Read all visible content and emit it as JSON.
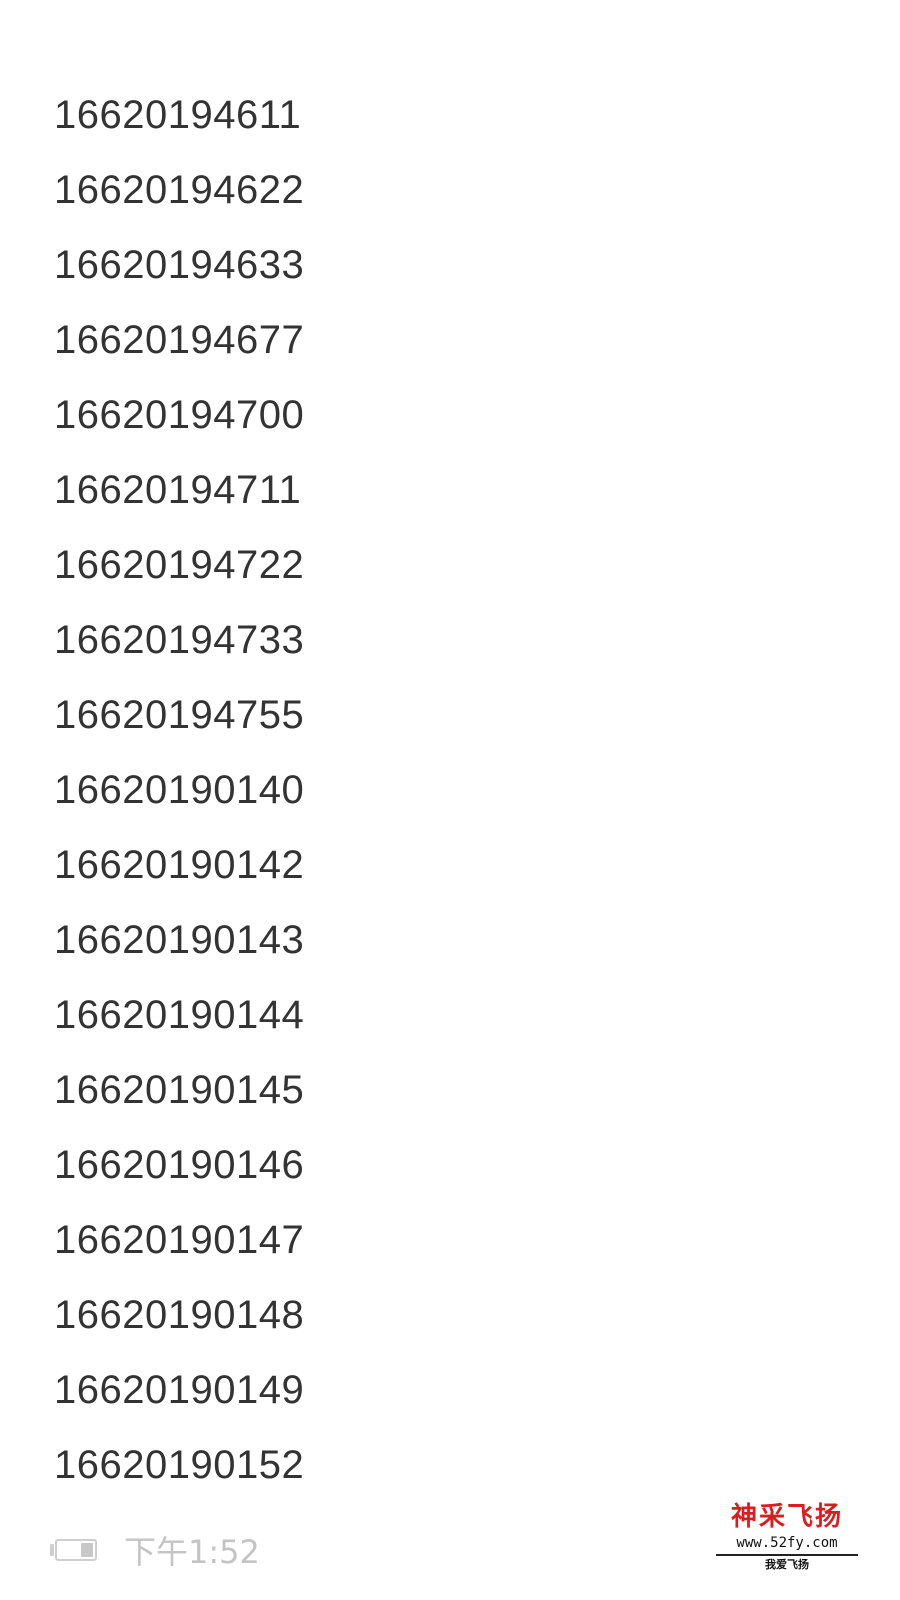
{
  "numbers": [
    "16620194611",
    "16620194622",
    "16620194633",
    "16620194677",
    "16620194700",
    "16620194711",
    "16620194722",
    "16620194733",
    "16620194755",
    "16620190140",
    "16620190142",
    "16620190143",
    "16620190144",
    "16620190145",
    "16620190146",
    "16620190147",
    "16620190148",
    "16620190149",
    "16620190152"
  ],
  "status_bar": {
    "time": "下午1:52",
    "battery_level": 0.35,
    "battery_icon": "battery-icon"
  },
  "watermark": {
    "title": "神采飞扬",
    "url": "www.52fy.com",
    "slogan": "我爱飞扬"
  },
  "colors": {
    "text": "#333333",
    "status_text": "#c4c4c4",
    "watermark_red": "#d81e1e"
  }
}
